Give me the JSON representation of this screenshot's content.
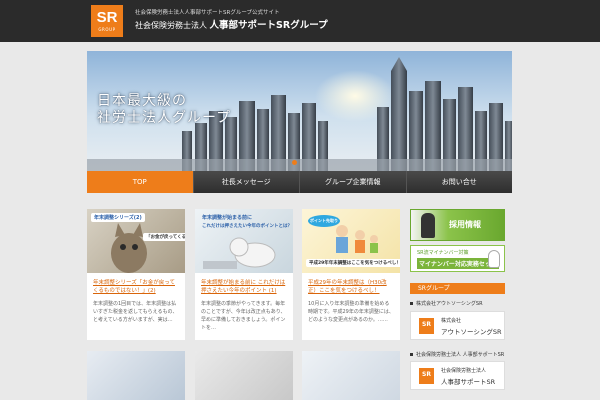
{
  "header": {
    "logo_main": "SR",
    "logo_sub": "GROUP",
    "tagline": "社会保険労務士法人人事部サポートSRグループ公式サイト",
    "company_prefix": "社会保険労務士法人",
    "company_name": "人事部サポートSRグループ"
  },
  "hero": {
    "line1": "日本最大級の",
    "line2": "社労士法人グループ"
  },
  "nav": {
    "items": [
      {
        "label": "TOP"
      },
      {
        "label": "社長メッセージ"
      },
      {
        "label": "グループ企業情報"
      },
      {
        "label": "お問い合せ"
      }
    ]
  },
  "cards": [
    {
      "thumb_label": "年末調整シリーズ(2)",
      "thumb_caption": "「お金が戻ってくる」ものではない！",
      "title": "年末調整シリーズ「お金が戻ってくるものではない！」(2)",
      "body": "年末調整の1回目では、年末調整は払いすぎた税金を返してもらえるもの、と考えている方がいますが、実は…"
    },
    {
      "thumb_label": "年末調整が始まる前に",
      "thumb_caption": "これだけは押さえたい今年のポイントとは？",
      "title": "年末調整が始まる前に これだけは押さえたい今年のポイント (1)",
      "body": "年末調整の季節がやってきます。毎年のことですが、今年は改正点もあり、早めに準備しておきましょう。ポイントを…"
    },
    {
      "thumb_label": "ポイント先取り",
      "thumb_caption": "平成29年年末調整はここを気をつけるべし！",
      "title": "平成29年の年末調整は（H30改正）ここを気をつけるべし！",
      "body": "10月に入り年末調整の準備を始める時期です。平成29年の年末調整には、どのような変更点があるのか。……"
    }
  ],
  "sidebar": {
    "recruit": "採用情報",
    "mynumber_line1": "SR流マイナンバー対策",
    "mynumber_line2": "マイナンバー対応実務セット",
    "group_header": "SRグループ",
    "companies": [
      {
        "link_label": "株式会社アウトソーシングSR",
        "badge": "SR",
        "name_line1": "株式会社",
        "name_line2": "アウトソーシングSR"
      },
      {
        "link_label": "社会保険労務士法人 人事部サポートSR",
        "badge": "SR",
        "name_line1": "社会保険労務士法人",
        "name_line2": "人事部サポートSR"
      }
    ]
  },
  "colors": {
    "accent": "#ee7d1a",
    "header_bg": "#2b2b2b",
    "page_bg": "#e9e9e9",
    "green": "#7bb43a"
  }
}
